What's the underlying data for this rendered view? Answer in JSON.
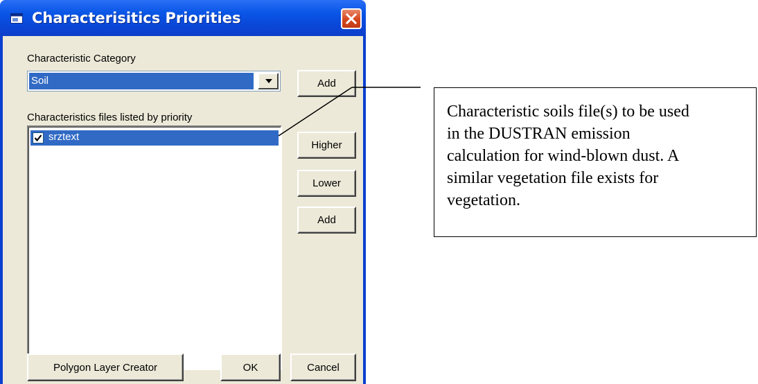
{
  "window": {
    "title": "Characterisitics Priorities",
    "title_icon": "window-icon",
    "close_icon": "close-icon"
  },
  "category": {
    "label": "Characteristic Category",
    "selected": "Soil",
    "add_label": "Add",
    "arrow_icon": "chevron-down-icon"
  },
  "files": {
    "label": "Characteristics files listed by priority",
    "items": [
      {
        "name": "srztext",
        "checked": true,
        "selected": true
      }
    ],
    "higher_label": "Higher",
    "lower_label": "Lower",
    "add_label": "Add"
  },
  "footer": {
    "polygon_label": "Polygon Layer Creator",
    "ok_label": "OK",
    "cancel_label": "Cancel"
  },
  "callout": {
    "text": "Characteristic soils file(s) to be used\nin the DUSTRAN emission\ncalculation for wind-blown dust.  A\nsimilar vegetation file exists for\nvegetation."
  },
  "colors": {
    "titlebar": "#0a56e6",
    "dialog_bg": "#ece9d8",
    "selection": "#316ac5",
    "close_button": "#d5461d"
  }
}
